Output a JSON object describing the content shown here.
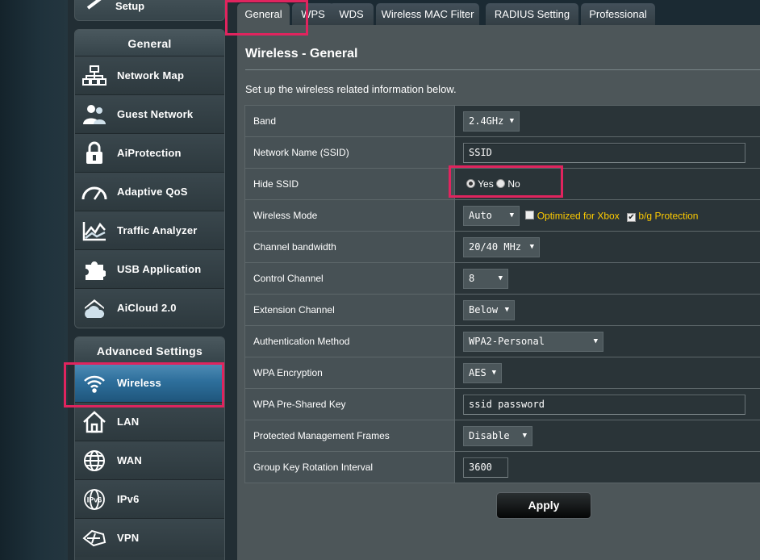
{
  "sidebar": {
    "setup_label": "Setup",
    "general_header": "General",
    "general_items": [
      {
        "label": "Network Map"
      },
      {
        "label": "Guest Network"
      },
      {
        "label": "AiProtection"
      },
      {
        "label": "Adaptive QoS"
      },
      {
        "label": "Traffic Analyzer"
      },
      {
        "label": "USB Application"
      },
      {
        "label": "AiCloud 2.0"
      }
    ],
    "advanced_header": "Advanced Settings",
    "advanced_items": [
      {
        "label": "Wireless"
      },
      {
        "label": "LAN"
      },
      {
        "label": "WAN"
      },
      {
        "label": "IPv6"
      },
      {
        "label": "VPN"
      }
    ]
  },
  "tabs": [
    {
      "label": "General"
    },
    {
      "label": "WPS"
    },
    {
      "label": "WDS"
    },
    {
      "label": "Wireless MAC Filter"
    },
    {
      "label": "RADIUS Setting"
    },
    {
      "label": "Professional"
    }
  ],
  "main": {
    "title": "Wireless - General",
    "description": "Set up the wireless related information below.",
    "fields": {
      "band": {
        "label": "Band",
        "value": "2.4GHz"
      },
      "ssid": {
        "label": "Network Name (SSID)",
        "value": "SSID"
      },
      "hide_ssid": {
        "label": "Hide SSID",
        "yes": "Yes",
        "no": "No"
      },
      "wireless_mode": {
        "label": "Wireless Mode",
        "value": "Auto",
        "opt1": "Optimized for Xbox",
        "opt2": "b/g Protection"
      },
      "channel_bandwidth": {
        "label": "Channel bandwidth",
        "value": "20/40 MHz"
      },
      "control_channel": {
        "label": "Control Channel",
        "value": "8"
      },
      "extension_channel": {
        "label": "Extension Channel",
        "value": "Below"
      },
      "auth_method": {
        "label": "Authentication Method",
        "value": "WPA2-Personal"
      },
      "wpa_encryption": {
        "label": "WPA Encryption",
        "value": "AES"
      },
      "wpa_psk": {
        "label": "WPA Pre-Shared Key",
        "value": "ssid password"
      },
      "pmf": {
        "label": "Protected Management Frames",
        "value": "Disable"
      },
      "group_key": {
        "label": "Group Key Rotation Interval",
        "value": "3600"
      }
    },
    "apply_label": "Apply"
  },
  "colors": {
    "highlight": "#e0245e",
    "active_item": "#2e6f9c",
    "option_label": "#ffcc00"
  }
}
